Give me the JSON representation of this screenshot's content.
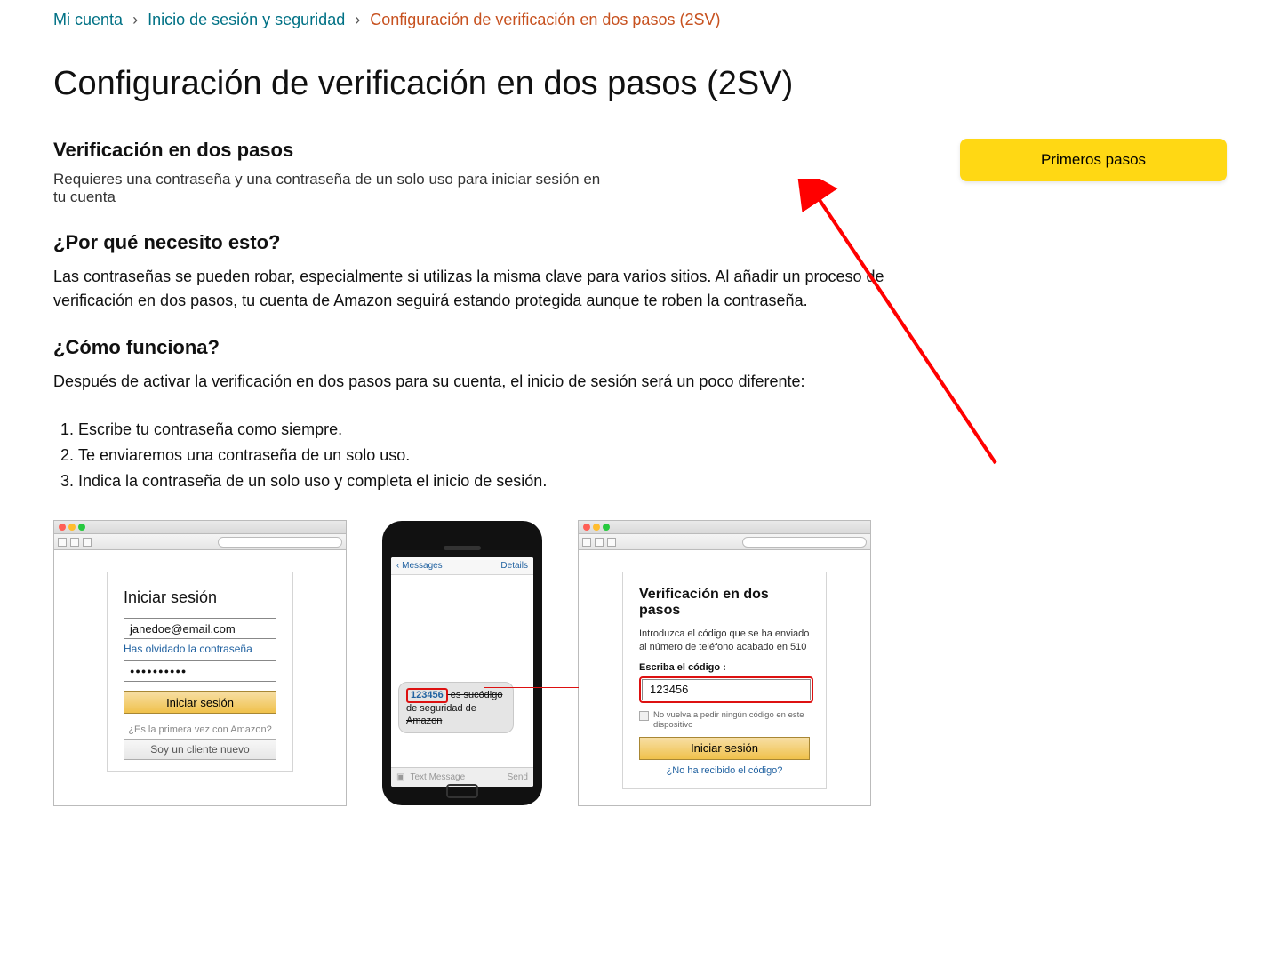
{
  "breadcrumb": {
    "items": [
      "Mi cuenta",
      "Inicio de sesión y seguridad"
    ],
    "current": "Configuración de verificación en dos pasos (2SV)"
  },
  "page_title": "Configuración de verificación en dos pasos (2SV)",
  "sub": {
    "heading": "Verificación en dos pasos",
    "desc": "Requieres una contraseña y una contraseña de un solo uso para iniciar sesión en tu cuenta"
  },
  "button_primary": "Primeros pasos",
  "why": {
    "heading": "¿Por qué necesito esto?",
    "body": "Las contraseñas se pueden robar, especialmente si utilizas la misma clave para varios sitios. Al añadir un proceso de verificación en dos pasos, tu cuenta de Amazon seguirá estando protegida aunque te roben la contraseña."
  },
  "how": {
    "heading": "¿Cómo funciona?",
    "intro": "Después de activar la verificación en dos pasos para su cuenta, el inicio de sesión será un poco diferente:",
    "steps": [
      "Escribe tu contraseña como siempre.",
      "Te enviaremos una contraseña de un solo uso.",
      "Indica la contraseña de un solo uso y completa el inicio de sesión."
    ]
  },
  "illus": {
    "login": {
      "title": "Iniciar sesión",
      "email": "janedoe@email.com",
      "forgot": "Has olvidado la contraseña",
      "password_mask": "●●●●●●●●●●",
      "signin_btn": "Iniciar sesión",
      "first_time": "¿Es la primera vez con Amazon?",
      "new_customer_btn": "Soy un cliente nuevo"
    },
    "phone": {
      "back": "Messages",
      "details": "Details",
      "code": "123456",
      "msg_rest": " es sucódigo de seguridad de Amazon",
      "placeholder": "Text Message",
      "send": "Send"
    },
    "twosv": {
      "title": "Verificación en dos pasos",
      "instr": "Introduzca el código que se ha enviado al número de teléfono acabado en 510",
      "label": "Escriba el código :",
      "code": "123456",
      "checkbox": "No vuelva a pedir ningún código en este dispositivo",
      "signin_btn": "Iniciar sesión",
      "noreceive": "¿No ha recibido el código?"
    }
  }
}
